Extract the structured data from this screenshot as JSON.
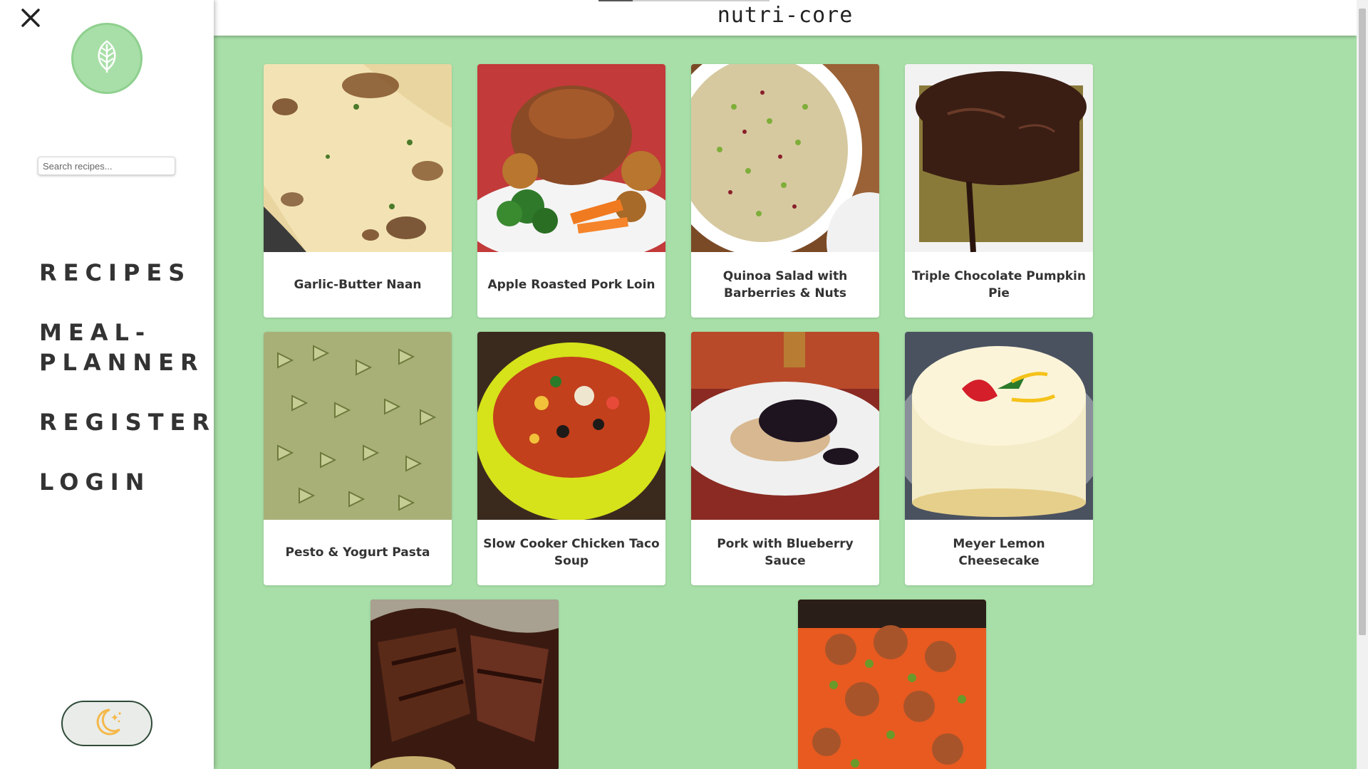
{
  "header": {
    "title": "nutri-core"
  },
  "sidebar": {
    "close_icon": "close-icon",
    "logo_icon": "leaf-icon",
    "search": {
      "placeholder": "Search recipes...",
      "value": ""
    },
    "nav": [
      {
        "label": "RECIPES"
      },
      {
        "label": "MEAL-PLANNER"
      },
      {
        "label": "REGISTER"
      },
      {
        "label": "LOGIN"
      }
    ],
    "theme_toggle_icon": "moon-stars-icon"
  },
  "colors": {
    "page_background": "#a8dfa8",
    "logo_green": "#a8dfa8",
    "text_dark": "#333333",
    "moon_orange": "#f5b84a"
  },
  "recipes": [
    {
      "title": "Garlic-Butter Naan"
    },
    {
      "title": "Apple Roasted Pork Loin"
    },
    {
      "title": "Quinoa Salad with Barberries & Nuts"
    },
    {
      "title": "Triple Chocolate Pumpkin Pie"
    },
    {
      "title": "Pesto & Yogurt Pasta"
    },
    {
      "title": "Slow Cooker Chicken Taco Soup"
    },
    {
      "title": "Pork with Blueberry Sauce"
    },
    {
      "title": "Meyer Lemon Cheesecake"
    }
  ]
}
